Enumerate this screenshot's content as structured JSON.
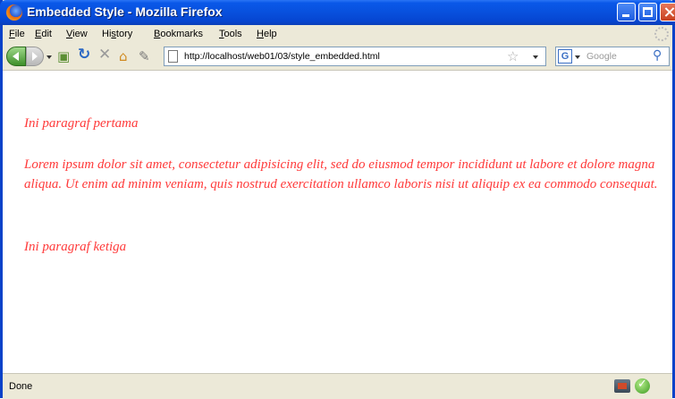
{
  "window": {
    "title": "Embedded Style - Mozilla Firefox"
  },
  "menu": {
    "items": [
      {
        "hotkey": "F",
        "rest": "ile"
      },
      {
        "hotkey": "E",
        "rest": "dit"
      },
      {
        "hotkey": "V",
        "rest": "iew"
      },
      {
        "prefix": "Hi",
        "hotkey": "s",
        "rest": "tory"
      },
      {
        "hotkey": "B",
        "rest": "ookmarks"
      },
      {
        "hotkey": "T",
        "rest": "ools"
      },
      {
        "hotkey": "H",
        "rest": "elp"
      }
    ]
  },
  "navbar": {
    "url": "http://localhost/web01/03/style_embedded.html",
    "search_placeholder": "Google",
    "search_engine_letter": "G"
  },
  "content": {
    "paragraphs": [
      "Ini paragraf pertama",
      "Lorem ipsum dolor sit amet, consectetur adipisicing elit, sed do eiusmod tempor incididunt ut labore et dolore magna aliqua. Ut enim ad minim veniam, quis nostrud exercitation ullamco laboris nisi ut aliquip ex ea commodo consequat.",
      "Ini paragraf ketiga"
    ],
    "text_color": "#ff3a3a"
  },
  "statusbar": {
    "text": "Done"
  },
  "colors": {
    "titlebar": "#0850dd",
    "chrome": "#ece9d8"
  },
  "icons": [
    "firefox-logo-icon",
    "back-icon",
    "forward-icon",
    "reload-icon",
    "stop-icon",
    "home-icon",
    "bookmark-tag-icon",
    "star-icon",
    "search-magnifier-icon",
    "checkmark-icon"
  ]
}
